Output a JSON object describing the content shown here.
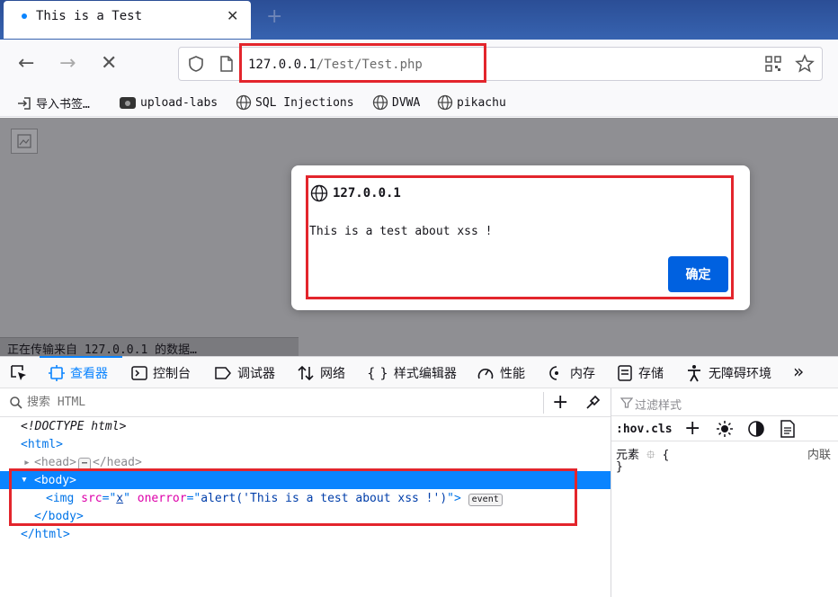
{
  "tab": {
    "title": "This is a Test",
    "close": "✕",
    "new_tab": "+"
  },
  "nav": {
    "back": "←",
    "forward": "→",
    "stop": "✕"
  },
  "url": {
    "host": "127.0.0.1",
    "path": "/Test/Test.php"
  },
  "bookmarks": [
    {
      "label": "导入书签…"
    },
    {
      "label": "upload-labs"
    },
    {
      "label": "SQL Injections"
    },
    {
      "label": "DVWA"
    },
    {
      "label": "pikachu"
    }
  ],
  "dialog": {
    "host": "127.0.0.1",
    "message": "This is a test about xss !",
    "ok_label": "确定"
  },
  "status": {
    "text": "正在传输来自 127.0.0.1 的数据…"
  },
  "devtools": {
    "tabs": [
      {
        "label": "查看器",
        "icon": "inspector-icon"
      },
      {
        "label": "控制台",
        "icon": "console-icon"
      },
      {
        "label": "调试器",
        "icon": "debugger-icon"
      },
      {
        "label": "网络",
        "icon": "network-icon"
      },
      {
        "label": "样式编辑器",
        "icon": "style-editor-icon"
      },
      {
        "label": "性能",
        "icon": "performance-icon"
      },
      {
        "label": "内存",
        "icon": "memory-icon"
      },
      {
        "label": "存储",
        "icon": "storage-icon"
      },
      {
        "label": "无障碍环境",
        "icon": "accessibility-icon"
      }
    ],
    "more": "»",
    "search_placeholder": "搜索 HTML",
    "tree": {
      "doctype": "<!DOCTYPE html>",
      "html_open": "<html>",
      "head_open": "<head>",
      "head_ellipsis": "⋯",
      "head_close": "</head>",
      "body_open": "<body>",
      "img_tag": "img",
      "src_attr": "src",
      "src_val": "x",
      "onerror_attr": "onerror",
      "onerror_val": "alert('This is a test about xss !')",
      "event_badge": "event",
      "body_close": "</body>",
      "html_close": "</html>"
    },
    "styles": {
      "filter_placeholder": "过滤样式",
      "hov_cls": ":hov.cls",
      "element_label": "元素",
      "brace_open": "{",
      "brace_close": "}",
      "inline_label": "内联"
    }
  },
  "colors": {
    "accent": "#0a84ff",
    "highlight_red": "#e3252c",
    "dialog_button": "#0061e0"
  }
}
